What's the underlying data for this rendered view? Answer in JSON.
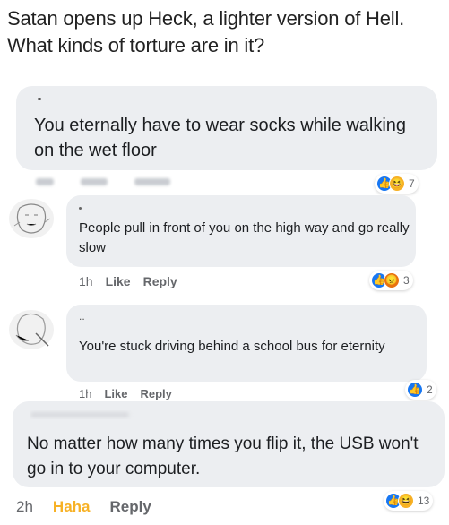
{
  "post": {
    "title": "Satan opens up Heck, a lighter version of Hell. What kinds of torture are in it?"
  },
  "comments": [
    {
      "text": "You eternally have to wear socks while walking on the wet floor",
      "reaction_count": "7",
      "reactions": [
        "like-icon",
        "haha-icon"
      ]
    },
    {
      "text": "People pull in front of you on the high way and go really slow",
      "time": "1h",
      "like_label": "Like",
      "reply_label": "Reply",
      "reaction_count": "3",
      "reactions": [
        "like-icon",
        "angry-icon"
      ]
    },
    {
      "author": "..",
      "text": "You're stuck driving behind a school bus for eternity",
      "time": "1h",
      "like_label": "Like",
      "reply_label": "Reply",
      "reaction_count": "2",
      "reactions": [
        "like-icon"
      ]
    },
    {
      "text": "No matter how many times you flip it, the USB won't go in to your computer.",
      "time": "2h",
      "haha_label": "Haha",
      "reply_label": "Reply",
      "reaction_count": "13",
      "reactions": [
        "like-icon",
        "haha-icon"
      ]
    }
  ],
  "colors": {
    "bubble": "#eceef1",
    "haha_action": "#f7b125",
    "like_blue": "#1877f2",
    "meta_text": "#65676b"
  }
}
